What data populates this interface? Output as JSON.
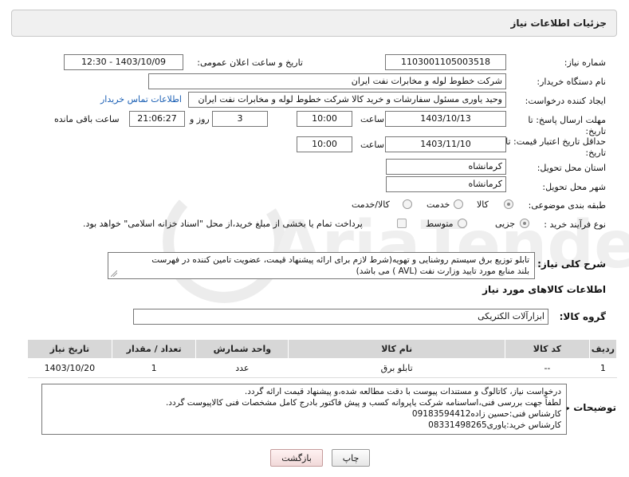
{
  "header": {
    "title": "جزئیات اطلاعات نیاز"
  },
  "form": {
    "need_number": {
      "label": "شماره نیاز:",
      "value": "1103001105003518"
    },
    "announce_datetime": {
      "label": "تاریخ و ساعت اعلان عمومی:",
      "value": "1403/10/09 - 12:30"
    },
    "buyer_org": {
      "label": "نام دستگاه خریدار:",
      "value": "شرکت خطوط لوله و مخابرات نفت ایران"
    },
    "requester": {
      "label": "ایجاد کننده درخواست:",
      "value": "وحید یاوری مسئول سفارشات و خرید کالا  شرکت خطوط لوله و مخابرات نفت ایران",
      "contact_link": "اطلاعات تماس خریدار"
    },
    "reply_deadline": {
      "label": "مهلت ارسال پاسخ: تا تاریخ:",
      "date": "1403/10/13",
      "time_label": "ساعت",
      "time": "10:00",
      "days": "3",
      "days_label": "روز و",
      "remaining": "21:06:27",
      "remaining_label": "ساعت باقی مانده"
    },
    "price_validity": {
      "label": "حداقل تاریخ اعتبار قیمت: تا تاریخ:",
      "date": "1403/11/10",
      "time_label": "ساعت",
      "time": "10:00"
    },
    "province": {
      "label": "استان محل تحویل:",
      "value": "کرمانشاه"
    },
    "city": {
      "label": "شهر محل تحویل:",
      "value": "کرمانشاه"
    },
    "category": {
      "label": "طبقه بندی موضوعی:",
      "options": [
        "کالا",
        "خدمت",
        "کالا/خدمت"
      ],
      "selected": 0
    },
    "purchase_type": {
      "label": "نوع فرآیند خرید :",
      "options": [
        "جزیی",
        "متوسط"
      ],
      "selected": 0,
      "note": "پرداخت تمام یا بخشی از مبلغ خرید،از محل \"اسناد خزانه اسلامی\" خواهد بود."
    }
  },
  "description": {
    "label": "شرح کلی نیاز:",
    "lines": [
      "تابلو توزیع برق سیستم روشنایی و تهویه(شرط لازم برای ارائه پیشنهاد قیمت، عضویت تامین کننده در فهرست",
      "بلند منابع مورد تایید وزارت نفت (AVL ) می باشد)"
    ]
  },
  "goods_section": {
    "title": "اطلاعات کالاهای مورد نیاز",
    "group_label": "گروه کالا:",
    "group_value": "ابزارآلات الکتریکی"
  },
  "table": {
    "headers": [
      "ردیف",
      "کد کالا",
      "نام کالا",
      "واحد شمارش",
      "تعداد / مقدار",
      "تاریخ نیاز"
    ],
    "rows": [
      [
        "1",
        "--",
        "تابلو برق",
        "عدد",
        "1",
        "1403/10/20"
      ]
    ]
  },
  "buyer_notes": {
    "label": "توضیحات خریدار:",
    "lines": [
      "درخواست نیاز، کاتالوگ و مستندات پیوست با دقت مطالعه شده،و پیشنهاد قیمت ارائه گردد.",
      "لطفاً جهت بررسی فنی،اساسنامه شرکت یاپروانه کسب و پیش فاکتور بادرج کامل مشخصات فنی کالاپیوست گردد.",
      "کارشناس فنی:حسین زاده09183594412",
      "کارشناس خرید:یاوری08331498265"
    ]
  },
  "buttons": {
    "print": "چاپ",
    "back": "بازگشت"
  },
  "watermark": {
    "text": "AriaTender.net"
  },
  "colors": {
    "link": "#1a5fb4",
    "table_header": "#d7d7d7",
    "panel": "#f0f0f0"
  }
}
